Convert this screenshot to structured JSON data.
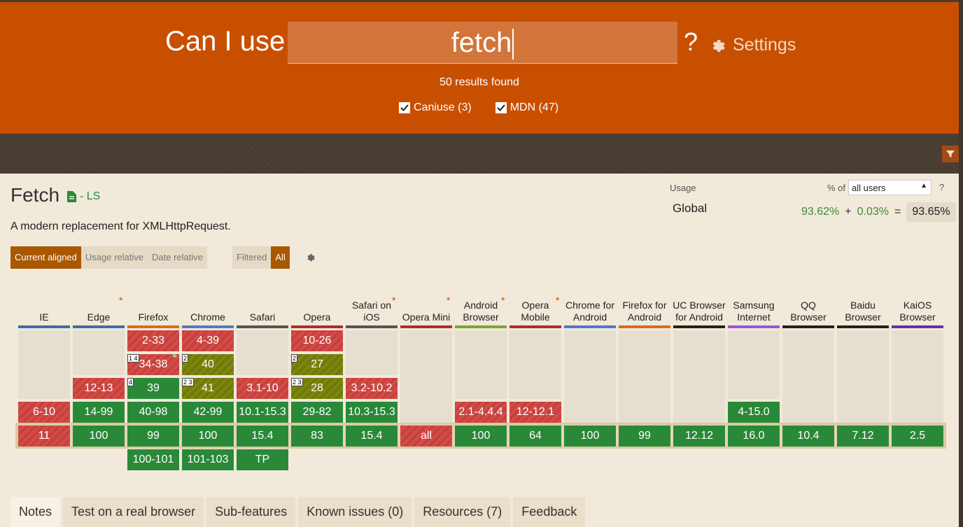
{
  "header": {
    "brand_text": "Can I use",
    "search_value": "fetch",
    "help": "?",
    "settings_label": "Settings",
    "results_text": "50 results found",
    "filters": [
      {
        "label": "Caniuse (3)",
        "checked": true
      },
      {
        "label": "MDN (47)",
        "checked": true
      }
    ]
  },
  "feature": {
    "title": "Fetch",
    "spec_label": "- LS",
    "description": "A modern replacement for XMLHttpRequest."
  },
  "usage": {
    "label": "Usage",
    "pct_of": "% of",
    "users_option": "all users",
    "help": "?",
    "region": "Global",
    "supported": "93.62%",
    "plus": "+",
    "partial": "0.03%",
    "equals": "=",
    "total": "93.65%"
  },
  "view_buttons": [
    "Current aligned",
    "Usage relative",
    "Date relative"
  ],
  "filter_buttons": [
    "Filtered",
    "All"
  ],
  "browsers": [
    {
      "name": "IE",
      "star": false,
      "bar_color": "#3b6ea8",
      "cells": [
        "",
        "",
        "",
        "6-10",
        "11",
        ""
      ]
    },
    {
      "name": "Edge",
      "star": true,
      "bar_color": "#3b6ea8",
      "cells": [
        "",
        "",
        "12-13",
        "14-99",
        "100",
        ""
      ]
    },
    {
      "name": "Firefox",
      "star": false,
      "bar_color": "#d96d1a",
      "cells": [
        "2-33",
        "34-38",
        "39",
        "40-98",
        "99",
        "100-101"
      ]
    },
    {
      "name": "Chrome",
      "star": false,
      "bar_color": "#4a7cc9",
      "cells": [
        "4-39",
        "40",
        "41",
        "42-99",
        "100",
        "101-103"
      ]
    },
    {
      "name": "Safari",
      "star": false,
      "bar_color": "#555555",
      "cells": [
        "",
        "",
        "3.1-10",
        "10.1-15.3",
        "15.4",
        "TP"
      ]
    },
    {
      "name": "Opera",
      "star": false,
      "bar_color": "#b22b2b",
      "cells": [
        "10-26",
        "27",
        "28",
        "29-82",
        "83",
        ""
      ]
    },
    {
      "name": "Safari on iOS",
      "star": true,
      "bar_color": "#555555",
      "cells": [
        "",
        "",
        "3.2-10.2",
        "10.3-15.3",
        "15.4",
        ""
      ]
    },
    {
      "name": "Opera Mini",
      "star": true,
      "bar_color": "#b22b2b",
      "cells": [
        "",
        "",
        "",
        "",
        "all",
        ""
      ]
    },
    {
      "name": "Android Browser",
      "star": true,
      "bar_color": "#7aa537",
      "cells": [
        "",
        "",
        "",
        "2.1-4.4.4",
        "100",
        ""
      ]
    },
    {
      "name": "Opera Mobile",
      "star": true,
      "bar_color": "#b22b2b",
      "cells": [
        "",
        "",
        "",
        "12-12.1",
        "64",
        ""
      ]
    },
    {
      "name": "Chrome for Android",
      "star": false,
      "bar_color": "#4a7cc9",
      "cells": [
        "",
        "",
        "",
        "",
        "100",
        ""
      ]
    },
    {
      "name": "Firefox for Android",
      "star": false,
      "bar_color": "#d96d1a",
      "cells": [
        "",
        "",
        "",
        "",
        "99",
        ""
      ]
    },
    {
      "name": "UC Browser for Android",
      "star": false,
      "bar_color": "#222222",
      "cells": [
        "",
        "",
        "",
        "",
        "12.12",
        ""
      ]
    },
    {
      "name": "Samsung Internet",
      "star": false,
      "bar_color": "#9955dd",
      "cells": [
        "",
        "",
        "",
        "4-15.0",
        "16.0",
        ""
      ]
    },
    {
      "name": "QQ Browser",
      "star": false,
      "bar_color": "#222222",
      "cells": [
        "",
        "",
        "",
        "",
        "10.4",
        ""
      ]
    },
    {
      "name": "Baidu Browser",
      "star": false,
      "bar_color": "#222222",
      "cells": [
        "",
        "",
        "",
        "",
        "7.12",
        ""
      ]
    },
    {
      "name": "KaiOS Browser",
      "star": false,
      "bar_color": "#6a2fa0",
      "cells": [
        "",
        "",
        "",
        "",
        "2.5",
        ""
      ]
    }
  ],
  "cell_notes": {
    "firefox_34_38": "1 4",
    "firefox_39": "4",
    "chrome_40": "2",
    "chrome_41": "2 3",
    "opera_27": "2",
    "opera_28": "2 3"
  },
  "colors": {
    "header": "#c84f00",
    "supported": "#2a8938",
    "unsupported": "#c8403e",
    "partial": "#6f7a09"
  },
  "tabs": [
    "Notes",
    "Test on a real browser",
    "Sub-features",
    "Known issues (0)",
    "Resources (7)",
    "Feedback"
  ]
}
